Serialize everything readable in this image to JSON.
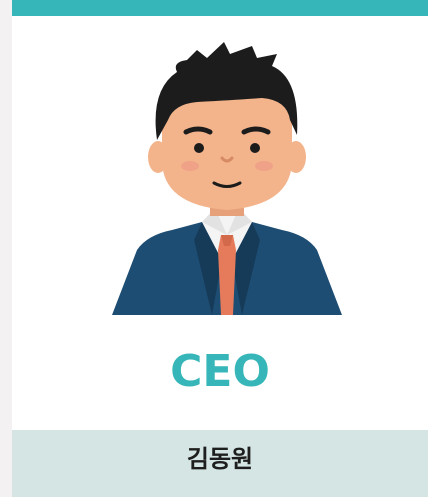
{
  "card": {
    "role": "CEO",
    "name": "김동원"
  },
  "icons": {
    "avatar": "businessman-avatar-icon"
  },
  "colors": {
    "accent": "#36b6b8",
    "name_bar": "#d4e5e3",
    "suit": "#1e4d73",
    "tie": "#e57b5b",
    "skin": "#f3b48c",
    "hair": "#1c1c1c"
  }
}
